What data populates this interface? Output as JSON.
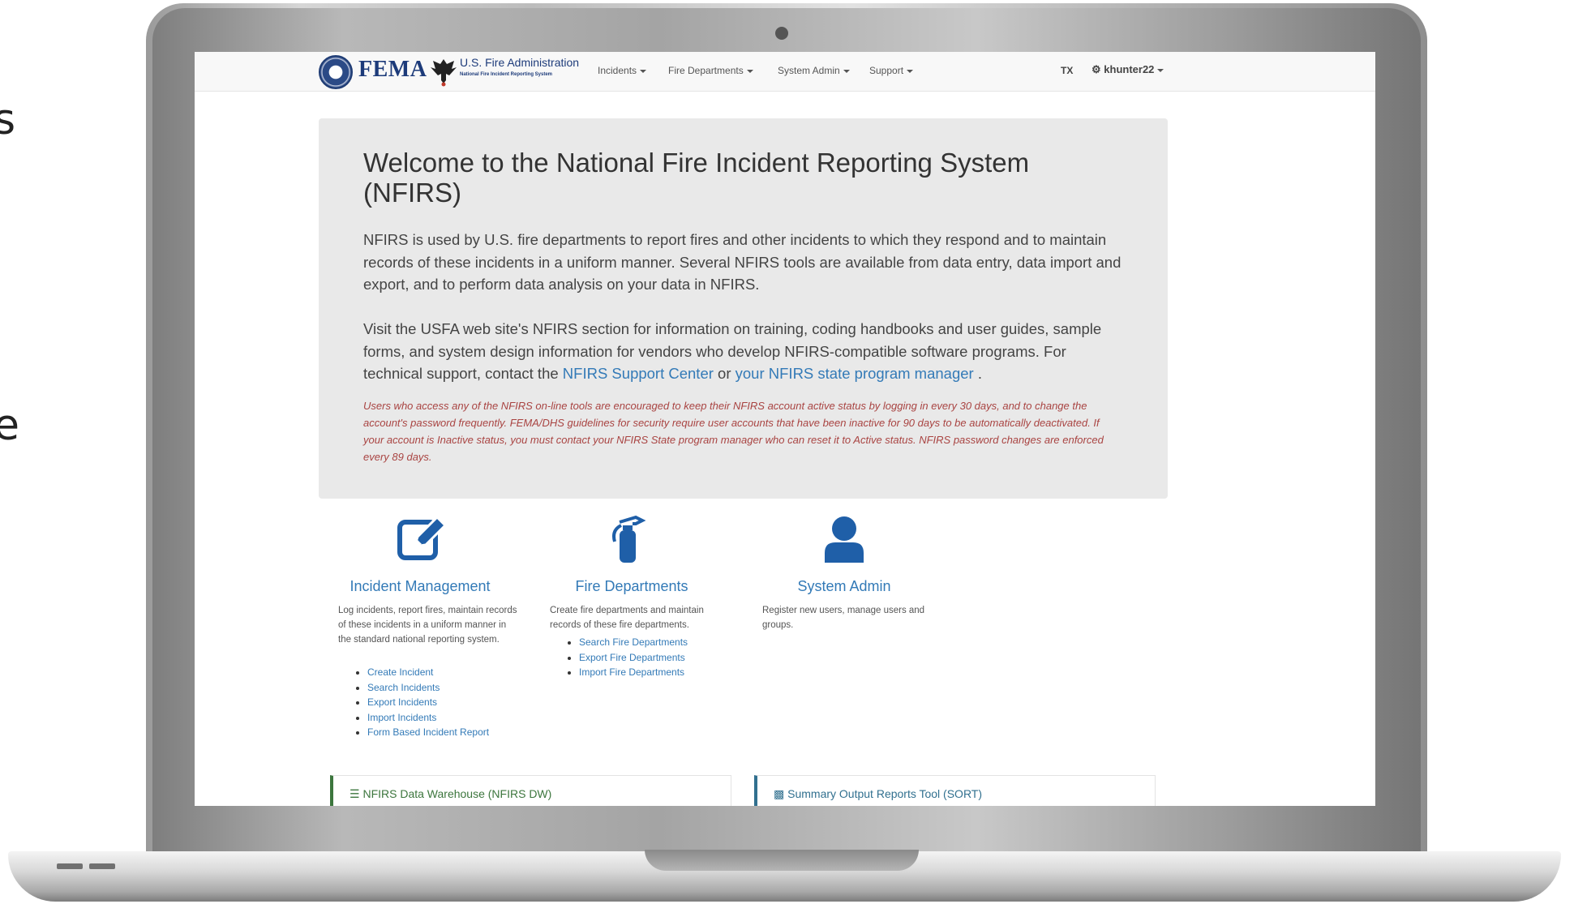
{
  "edge_chars": [
    "s",
    "e"
  ],
  "navbar": {
    "fema_label": "FEMA",
    "usfa_title": "U.S. Fire Administration",
    "usfa_subtitle": "National Fire Incident Reporting System",
    "menus": [
      {
        "label": "Incidents"
      },
      {
        "label": "Fire Departments"
      },
      {
        "label": "System Admin"
      },
      {
        "label": "Support"
      }
    ],
    "state": "TX",
    "username": "khunter22",
    "icons": [
      "fema-seal-icon",
      "usfa-eagle-icon",
      "gear-icon",
      "caret-down-icon"
    ]
  },
  "jumbotron": {
    "title": "Welcome to the National Fire Incident Reporting System (NFIRS)",
    "p1": "NFIRS is used by U.S. fire departments to report fires and other incidents to which they respond and to maintain records of these incidents in a uniform manner. Several NFIRS tools are available from data entry, data import and export, and to perform data analysis on your data in NFIRS.",
    "p2_text": "Visit the USFA web site's NFIRS section for information on training, coding handbooks and user guides, sample forms, and system design information for vendors who develop NFIRS-compatible software programs. For technical support, contact the",
    "p2_link1": "NFIRS Support Center",
    "p2_or": "or",
    "p2_link2": "your NFIRS state program manager",
    "p2_end": ".",
    "warning": "Users who access any of the NFIRS on-line tools are encouraged to keep their NFIRS account active status by logging in every 30 days, and to change the account's password frequently. FEMA/DHS guidelines for security require user accounts that have been inactive for 90 days to be automatically deactivated. If your account is Inactive status, you must contact your NFIRS State program manager who can reset it to Active status. NFIRS password changes are enforced every 89 days."
  },
  "features": [
    {
      "icon": "edit-icon",
      "title": "Incident Management",
      "description": "Log incidents, report fires, maintain records of these incidents in a uniform manner in the standard national reporting system.",
      "links": [
        "Create Incident",
        "Search Incidents",
        "Export Incidents",
        "Import Incidents",
        "Form Based Incident Report"
      ]
    },
    {
      "icon": "fire-extinguisher-icon",
      "title": "Fire Departments",
      "description": "Create fire departments and maintain records of these fire departments.",
      "links": [
        "Search Fire Departments",
        "Export Fire Departments",
        "Import Fire Departments"
      ]
    },
    {
      "icon": "user-icon",
      "title": "System Admin",
      "description": "Register new users, manage users and groups.",
      "links": []
    }
  ],
  "panels": [
    {
      "icon": "database-icon",
      "title": "NFIRS Data Warehouse (NFIRS DW)",
      "color": "#3c763d"
    },
    {
      "icon": "bar-chart-icon",
      "title": "Summary Output Reports Tool (SORT)",
      "color": "#31708f"
    }
  ],
  "colors": {
    "link": "#337ab7",
    "warning": "#a94442",
    "jumbotron_bg": "#e9e9e9",
    "icon_blue": "#1f5fa8"
  }
}
